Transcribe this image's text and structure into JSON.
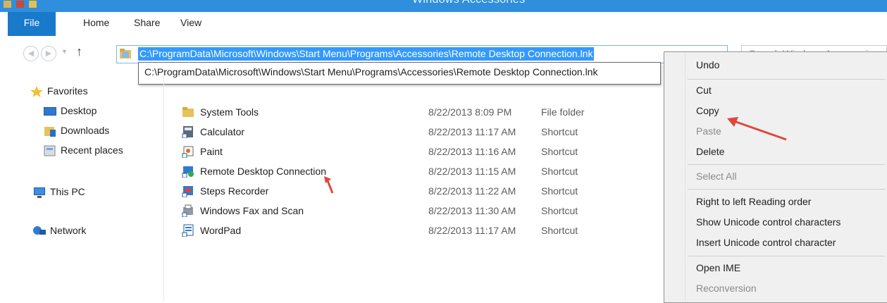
{
  "window": {
    "title": "Windows Accessories"
  },
  "ribbon": {
    "tabs": [
      "File",
      "Home",
      "Share",
      "View"
    ]
  },
  "address": {
    "path": "C:\\ProgramData\\Microsoft\\Windows\\Start Menu\\Programs\\Accessories\\Remote Desktop Connection.lnk",
    "autocomplete": "C:\\ProgramData\\Microsoft\\Windows\\Start Menu\\Programs\\Accessories\\Remote Desktop Connection.lnk"
  },
  "search": {
    "placeholder": "Search Windows Accessories"
  },
  "nav": {
    "favorites": "Favorites",
    "desktop": "Desktop",
    "downloads": "Downloads",
    "recent": "Recent places",
    "thispc": "This PC",
    "network": "Network"
  },
  "files": [
    {
      "name": "System Tools",
      "date": "8/22/2013 8:09 PM",
      "type": "File folder",
      "icon": "folder-icon"
    },
    {
      "name": "Calculator",
      "date": "8/22/2013 11:17 AM",
      "type": "Shortcut",
      "icon": "calculator-icon"
    },
    {
      "name": "Paint",
      "date": "8/22/2013 11:16 AM",
      "type": "Shortcut",
      "icon": "paint-icon"
    },
    {
      "name": "Remote Desktop Connection",
      "date": "8/22/2013 11:15 AM",
      "type": "Shortcut",
      "icon": "remote-desktop-icon"
    },
    {
      "name": "Steps Recorder",
      "date": "8/22/2013 11:22 AM",
      "type": "Shortcut",
      "icon": "steps-recorder-icon"
    },
    {
      "name": "Windows Fax and Scan",
      "date": "8/22/2013 11:30 AM",
      "type": "Shortcut",
      "icon": "fax-scan-icon"
    },
    {
      "name": "WordPad",
      "date": "8/22/2013 11:17 AM",
      "type": "Shortcut",
      "icon": "wordpad-icon"
    }
  ],
  "context_menu": {
    "undo": "Undo",
    "cut": "Cut",
    "copy": "Copy",
    "paste": "Paste",
    "delete": "Delete",
    "select_all": "Select All",
    "rtl": "Right to left Reading order",
    "show_unicode": "Show Unicode control characters",
    "insert_unicode": "Insert Unicode control character",
    "open_ime": "Open IME",
    "reconversion": "Reconversion"
  },
  "colors": {
    "accent": "#1979ca",
    "selection": "#3399ff",
    "annotation_arrow": "#e0473b"
  }
}
